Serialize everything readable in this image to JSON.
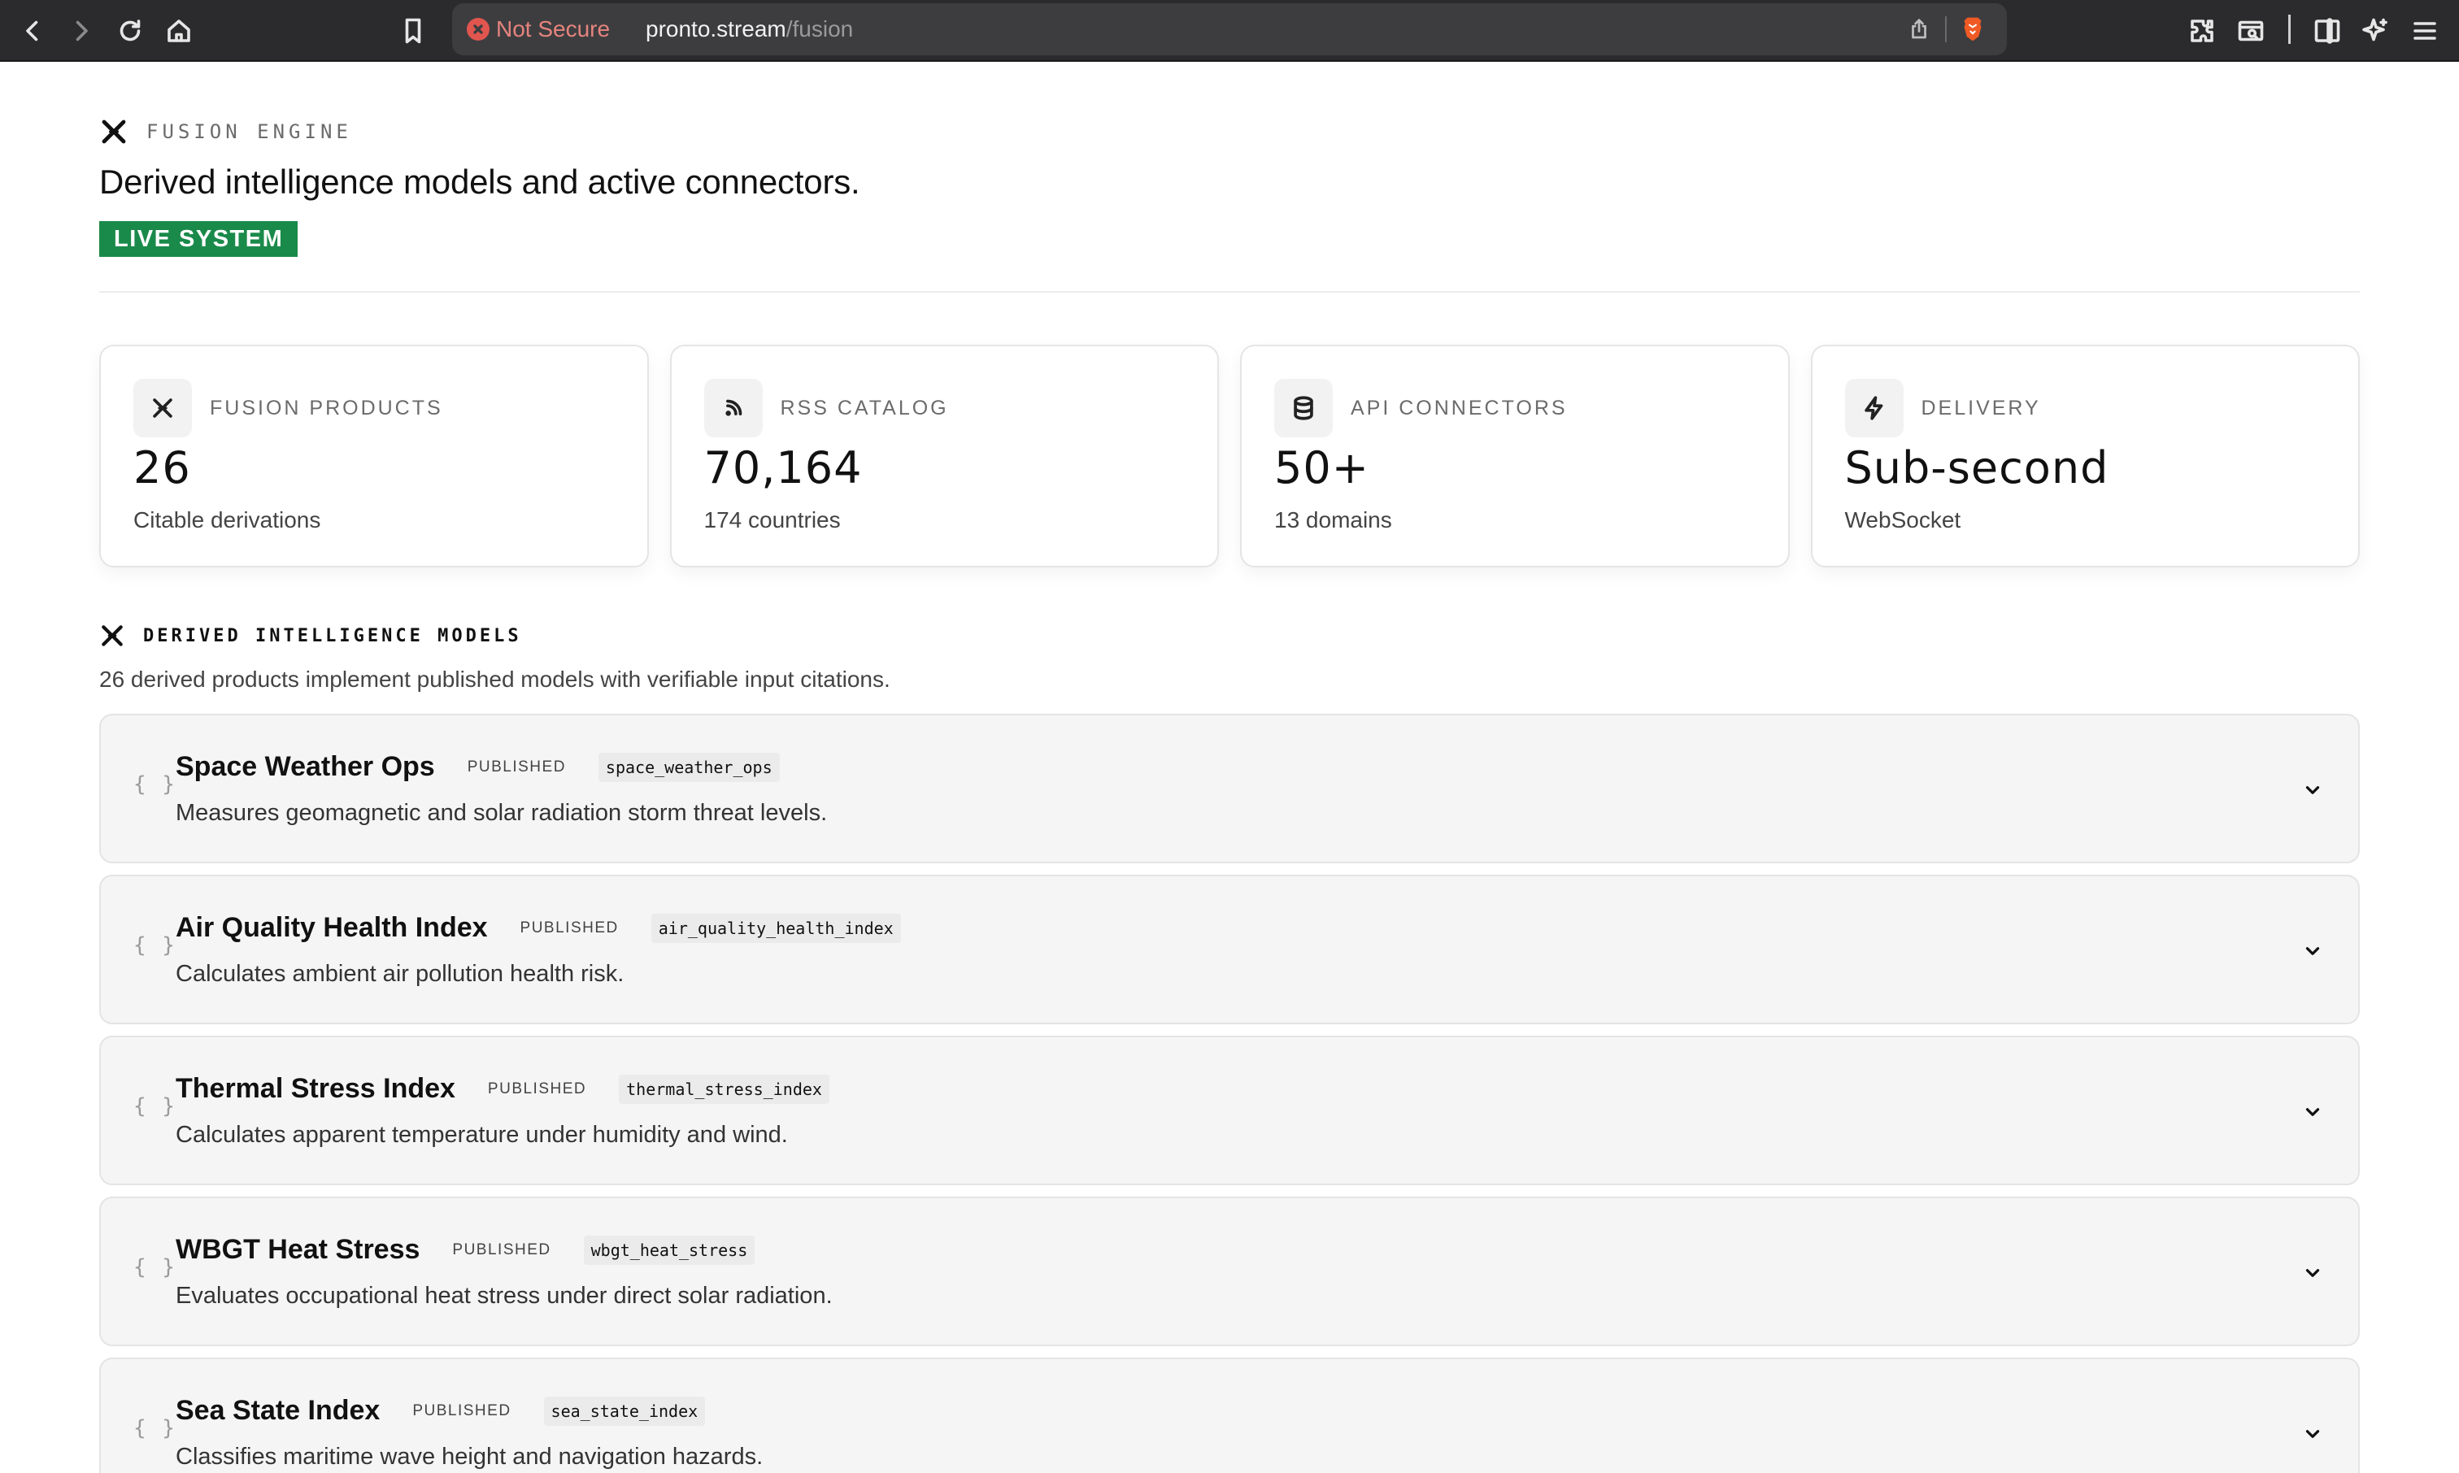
{
  "browser": {
    "security_label": "Not Secure",
    "url_host": "pronto.stream",
    "url_path": "/fusion"
  },
  "header": {
    "eyebrow": "FUSION ENGINE",
    "title": "Derived intelligence models and active connectors.",
    "badge": "LIVE SYSTEM",
    "badge_color": "#1a8a4a"
  },
  "stats": [
    {
      "icon": "fusion-icon",
      "label": "FUSION PRODUCTS",
      "value": "26",
      "sub": "Citable derivations"
    },
    {
      "icon": "rss-icon",
      "label": "RSS CATALOG",
      "value": "70,164",
      "sub": "174 countries"
    },
    {
      "icon": "database-icon",
      "label": "API CONNECTORS",
      "value": "50+",
      "sub": "13 domains"
    },
    {
      "icon": "bolt-icon",
      "label": "DELIVERY",
      "value": "Sub-second",
      "sub": "WebSocket"
    }
  ],
  "models_section": {
    "heading": "DERIVED INTELLIGENCE MODELS",
    "description": "26 derived products implement published models with verifiable input citations.",
    "items": [
      {
        "icon": "{ }",
        "name": "Space Weather Ops",
        "status": "PUBLISHED",
        "code": "space_weather_ops",
        "desc": "Measures geomagnetic and solar radiation storm threat levels."
      },
      {
        "icon": "{ }",
        "name": "Air Quality Health Index",
        "status": "PUBLISHED",
        "code": "air_quality_health_index",
        "desc": "Calculates ambient air pollution health risk."
      },
      {
        "icon": "{ }",
        "name": "Thermal Stress Index",
        "status": "PUBLISHED",
        "code": "thermal_stress_index",
        "desc": "Calculates apparent temperature under humidity and wind."
      },
      {
        "icon": "{ }",
        "name": "WBGT Heat Stress",
        "status": "PUBLISHED",
        "code": "wbgt_heat_stress",
        "desc": "Evaluates occupational heat stress under direct solar radiation."
      },
      {
        "icon": "{ }",
        "name": "Sea State Index",
        "status": "PUBLISHED",
        "code": "sea_state_index",
        "desc": "Classifies maritime wave height and navigation hazards."
      }
    ]
  }
}
